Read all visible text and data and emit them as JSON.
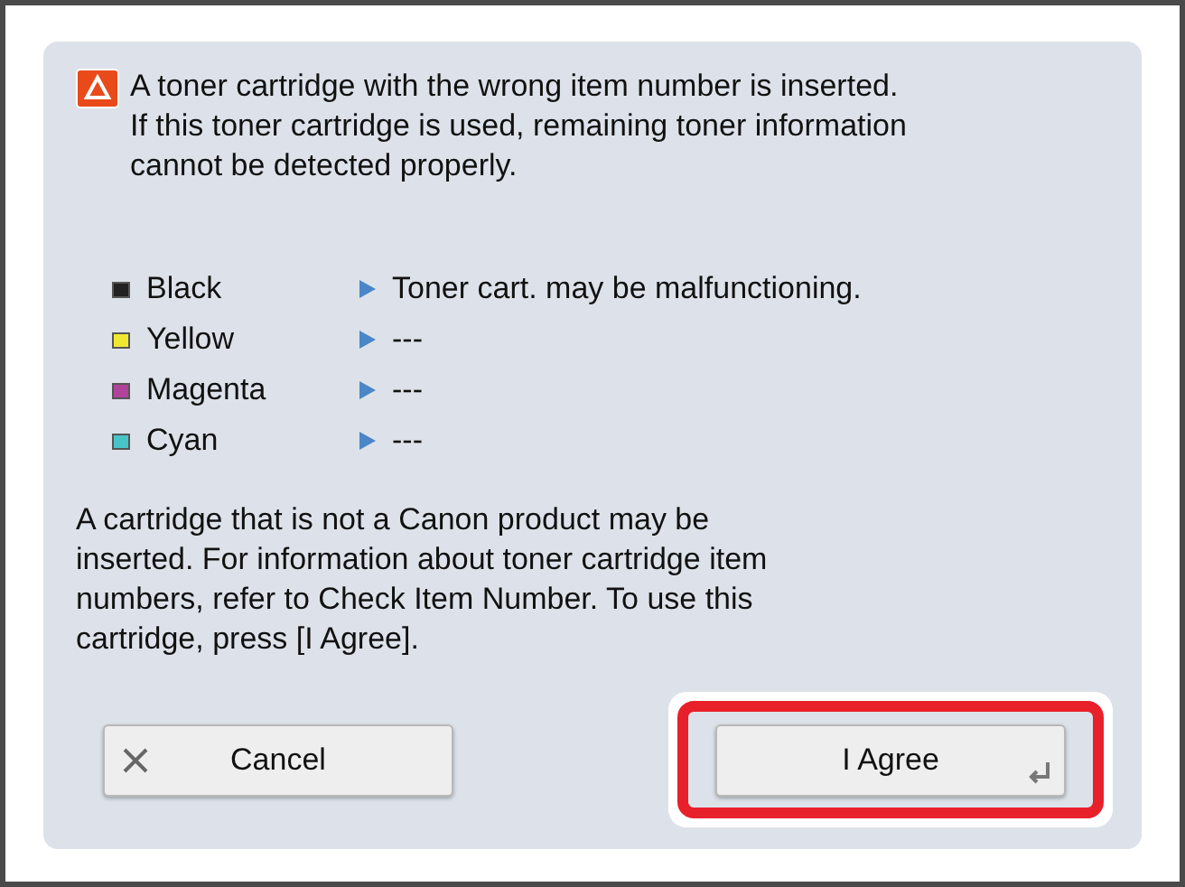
{
  "message": "A toner cartridge with the wrong item number is inserted. If this toner cartridge is used, remaining toner information cannot be detected properly.",
  "toners": [
    {
      "name": "Black",
      "color": "#222222",
      "status": "Toner cart. may be malfunctioning."
    },
    {
      "name": "Yellow",
      "color": "#f0e830",
      "status": "---"
    },
    {
      "name": "Magenta",
      "color": "#b0449a",
      "status": "---"
    },
    {
      "name": "Cyan",
      "color": "#48c4c8",
      "status": "---"
    }
  ],
  "note": "A cartridge that is not a Canon product may be inserted. For information about toner cartridge item numbers, refer to Check Item Number. To use this cartridge, press [I Agree].",
  "buttons": [
    {
      "kind": "cancel",
      "label": "Cancel",
      "highlighted": false
    },
    {
      "kind": "confirm",
      "label": "I Agree",
      "highlighted": true
    }
  ]
}
